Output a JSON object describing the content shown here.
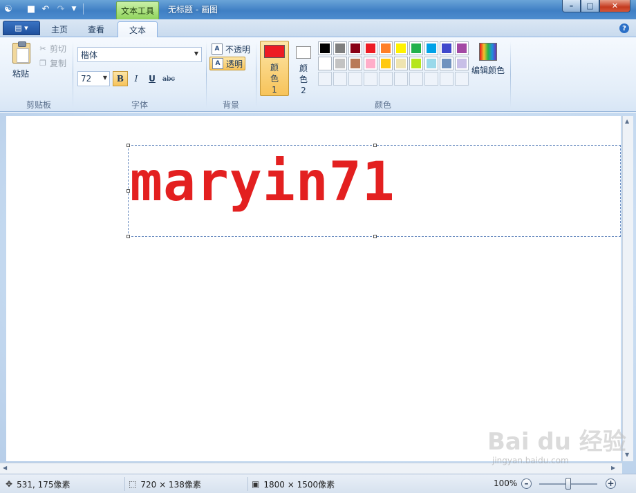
{
  "titlebar": {
    "context_tab": "文本工具",
    "window_title": "无标题 - 画图"
  },
  "tabs": {
    "home": "主页",
    "view": "查看",
    "text": "文本"
  },
  "clipboard": {
    "paste": "粘贴",
    "cut": "剪切",
    "copy": "复制",
    "group": "剪贴板"
  },
  "font": {
    "family": "楷体",
    "size": "72",
    "bold": "B",
    "italic": "I",
    "underline": "U",
    "strikethrough": "abc",
    "group": "字体"
  },
  "background": {
    "opaque": "不透明",
    "transparent": "透明",
    "group": "背景"
  },
  "colors": {
    "color1_label": "颜色 1",
    "color2_label": "颜色 2",
    "color1_value": "#ed1c24",
    "color2_value": "#ffffff",
    "edit": "编辑颜色",
    "group": "颜色",
    "palette_row1": [
      "#000000",
      "#7f7f7f",
      "#880015",
      "#ed1c24",
      "#ff7f27",
      "#fff200",
      "#22b14c",
      "#00a2e8",
      "#3f48cc",
      "#a349a4"
    ],
    "palette_row2": [
      "#ffffff",
      "#c3c3c3",
      "#b97a57",
      "#ffaec9",
      "#ffc90e",
      "#efe4b0",
      "#b5e61d",
      "#99d9ea",
      "#7092be",
      "#c8bfe7"
    ]
  },
  "canvas": {
    "text": "maryin71",
    "text_color": "#e32020"
  },
  "status": {
    "cursor": "531, 175像素",
    "selection": "720 × 138像素",
    "image_size": "1800 × 1500像素",
    "zoom": "100%"
  },
  "watermark": {
    "brand": "Bai du 经验",
    "url": "jingyan.baidu.com"
  }
}
